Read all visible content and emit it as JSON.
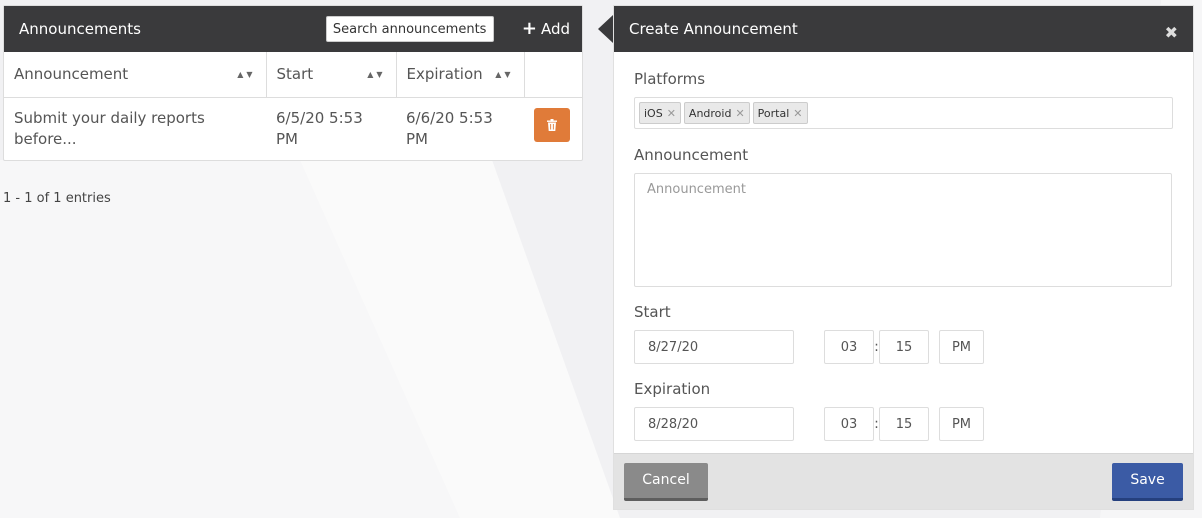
{
  "list": {
    "title": "Announcements",
    "search_placeholder": "Search announcements...",
    "add_label": "Add",
    "columns": {
      "announcement": "Announcement",
      "start": "Start",
      "expiration": "Expiration"
    },
    "rows": [
      {
        "announcement": "Submit your daily reports before...",
        "start": "6/5/20 5:53 PM",
        "expiration": "6/6/20 5:53 PM"
      }
    ],
    "entries_text": "1 - 1 of 1 entries"
  },
  "modal": {
    "title": "Create Announcement",
    "platforms_label": "Platforms",
    "platforms": [
      "iOS",
      "Android",
      "Portal"
    ],
    "announcement_label": "Announcement",
    "announcement_placeholder": "Announcement",
    "start_label": "Start",
    "start": {
      "date": "8/27/20",
      "hour": "03",
      "minute": "15",
      "ampm": "PM"
    },
    "expiration_label": "Expiration",
    "expiration": {
      "date": "8/28/20",
      "hour": "03",
      "minute": "15",
      "ampm": "PM"
    },
    "cancel_label": "Cancel",
    "save_label": "Save"
  },
  "colors": {
    "header_bg": "#3a3a3c",
    "delete": "#e07b39",
    "save": "#3b5ba5",
    "cancel": "#8a8a8a"
  }
}
